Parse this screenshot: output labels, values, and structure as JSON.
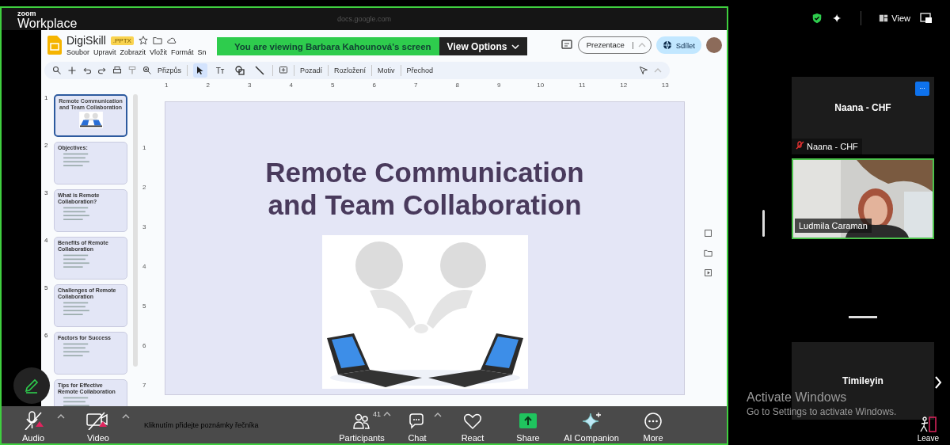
{
  "app": {
    "brand_small": "zoom",
    "brand": "Workplace"
  },
  "browser": {
    "address": "docs.google.com"
  },
  "share_banner": {
    "text": "You are viewing  Barbara Kahounová's screen",
    "button": "View Options"
  },
  "slides": {
    "doc_title": "DigiSkill",
    "file_badge": ".PPTX",
    "menu": [
      "Soubor",
      "Upravit",
      "Zobrazit",
      "Vložit",
      "Formát",
      "Sn"
    ],
    "present_button": "Prezentace",
    "share_button": "Sdílet",
    "zoom_fit": "Přizpůs",
    "tools": [
      {
        "kind": "select",
        "selected": true
      },
      {
        "kind": "text",
        "glyph": "Tт",
        "selected": false
      },
      {
        "kind": "shape",
        "selected": false
      },
      {
        "kind": "line",
        "selected": false
      }
    ],
    "actions": [
      "Pozadí",
      "Rozložení",
      "Motiv",
      "Přechod"
    ],
    "ruler_h": [
      "1",
      "2",
      "3",
      "4",
      "5",
      "6",
      "7",
      "8",
      "9",
      "10",
      "11",
      "12",
      "13"
    ],
    "ruler_v": [
      "1",
      "2",
      "3",
      "4",
      "5",
      "6",
      "7"
    ],
    "thumbnails": [
      {
        "number": "1",
        "kind": "title",
        "title": "Remote Communication and Team Collaboration",
        "selected": true
      },
      {
        "number": "2",
        "kind": "content",
        "title": "Objectives:",
        "selected": false
      },
      {
        "number": "3",
        "kind": "content",
        "title": "What is Remote Collaboration?",
        "selected": false
      },
      {
        "number": "4",
        "kind": "content",
        "title": "Benefits of Remote Collaboration",
        "selected": false
      },
      {
        "number": "5",
        "kind": "content",
        "title": "Challenges of Remote Collaboration",
        "selected": false
      },
      {
        "number": "6",
        "kind": "content",
        "title": "Factors for Success",
        "selected": false
      },
      {
        "kind": "content",
        "title": "Tips for Effective Remote Collaboration",
        "selected": false
      }
    ],
    "slide": {
      "title_lines": [
        "Remote Communication",
        "and Team Collaboration"
      ]
    },
    "notes_placeholder": "Kliknutím přidejte poznámky řečníka"
  },
  "meeting_toolbar": {
    "items": [
      {
        "kind": "audio",
        "label": "Audio",
        "muted": true
      },
      {
        "kind": "video",
        "label": "Video",
        "muted": true
      },
      {
        "kind": "participants",
        "label": "Participants",
        "count": "41"
      },
      {
        "kind": "chat",
        "label": "Chat"
      },
      {
        "kind": "react",
        "label": "React"
      },
      {
        "kind": "share",
        "label": "Share"
      },
      {
        "kind": "ai",
        "label": "AI Companion"
      },
      {
        "kind": "more",
        "label": "More"
      }
    ],
    "leave": "Leave"
  },
  "top_right": {
    "view": "View"
  },
  "participants": [
    {
      "kind": "avatar",
      "name": "Naana - CHF",
      "label": "Naana - CHF",
      "more_button": "...",
      "muted": true,
      "active": false
    },
    {
      "kind": "video",
      "label": "Ludmila Caraman",
      "muted": false,
      "active": true
    },
    {
      "kind": "avatar",
      "name": "Timileyin",
      "active": false
    }
  ],
  "system_notice": {
    "title": "Activate Windows",
    "text": "Go to Settings to activate Windows."
  }
}
